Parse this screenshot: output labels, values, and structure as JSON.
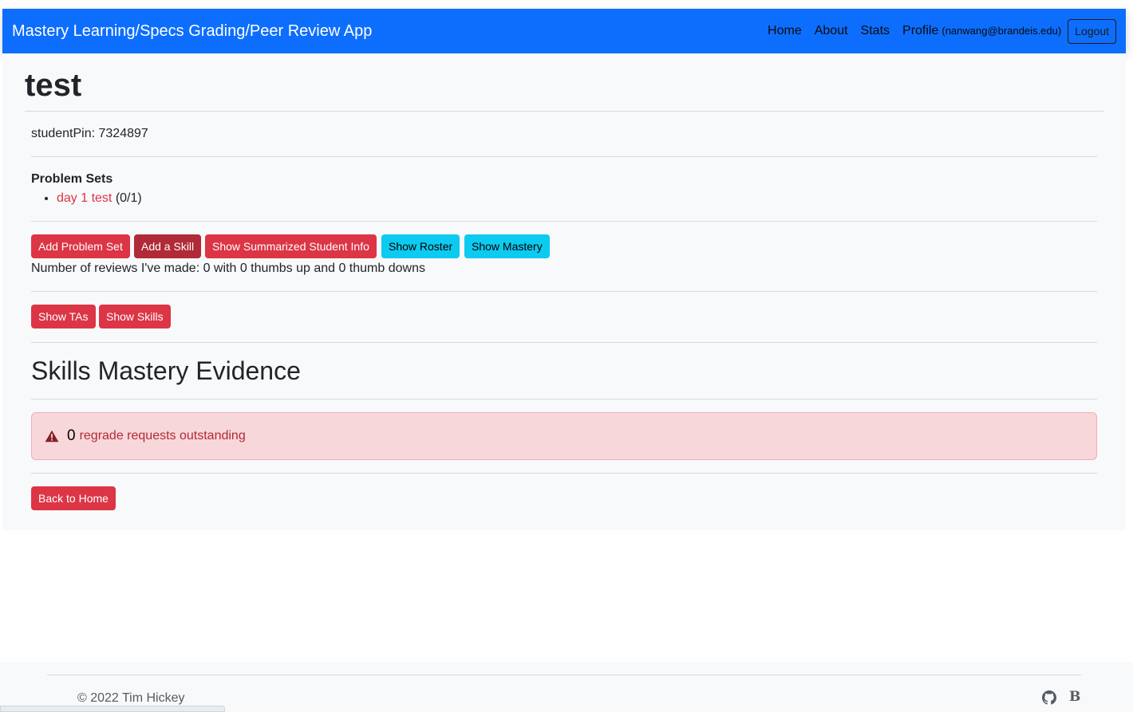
{
  "navbar": {
    "brand": "Mastery Learning/Specs Grading/Peer Review App",
    "links": {
      "home": "Home",
      "about": "About",
      "stats": "Stats",
      "profile": "Profile",
      "profile_email": "(nanwang@brandeis.edu)"
    },
    "logout": "Logout"
  },
  "course": {
    "title": "test",
    "student_pin": "studentPin: 7324897"
  },
  "problem_sets": {
    "heading": "Problem Sets",
    "items": [
      {
        "name": "day 1 test",
        "score": "(0/1)"
      }
    ]
  },
  "actions": {
    "add_problem_set": "Add Problem Set",
    "add_skill": "Add a Skill",
    "show_summarized": "Show Summarized Student Info",
    "show_roster": "Show Roster",
    "show_mastery": "Show Mastery",
    "show_tas": "Show TAs",
    "show_skills": "Show Skills",
    "back_home": "Back to Home"
  },
  "reviews_text": "Number of reviews I've made: 0 with 0 thumbs up and 0 thumb downs",
  "skills_section": {
    "heading": "Skills Mastery Evidence"
  },
  "alert": {
    "count": "0",
    "message": "regrade requests outstanding",
    "icon": "warning-triangle-icon"
  },
  "footer": {
    "copyright": "© 2022 Tim Hickey",
    "icons": [
      "github-icon",
      "bootstrap-icon"
    ]
  },
  "colors": {
    "navbar": "#0d6efd",
    "danger": "#dc3545",
    "info": "#0dcaf0",
    "alert_bg": "#f8d7da"
  }
}
